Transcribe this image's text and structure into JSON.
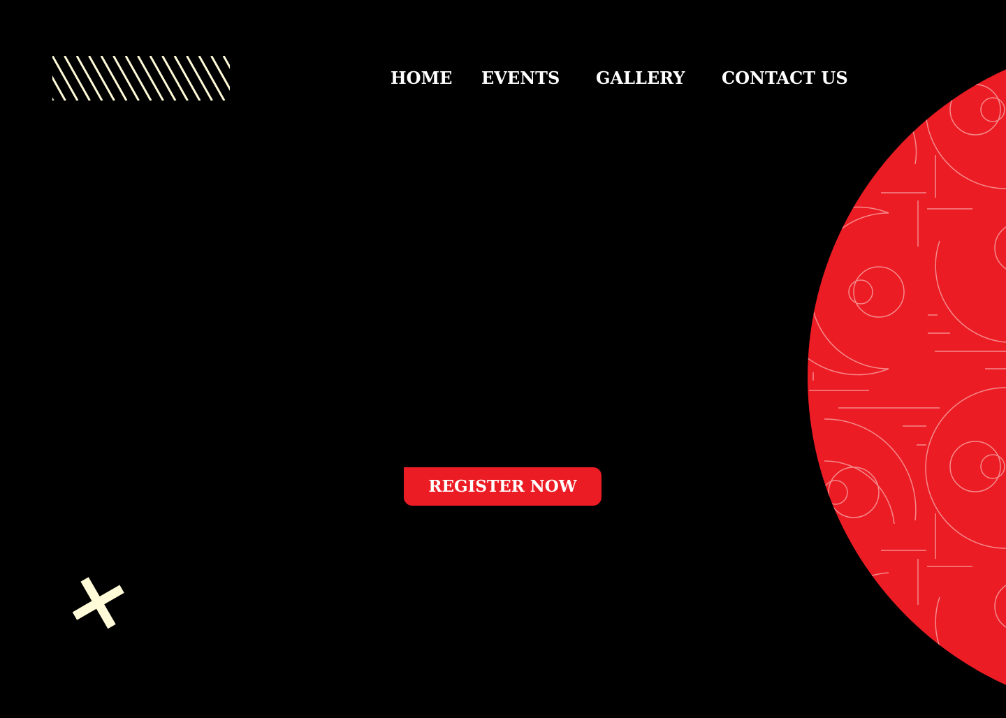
{
  "nav": {
    "items": [
      {
        "label": "HOME"
      },
      {
        "label": "EVENTS"
      },
      {
        "label": "GALLERY"
      },
      {
        "label": "CONTACT US"
      }
    ]
  },
  "hero": {
    "cta_label": "REGISTER NOW"
  },
  "colors": {
    "background": "#000000",
    "accent": "#ec1c24",
    "cream": "#fffbd8",
    "nav_text": "#ffffff",
    "pattern_line": "#f48a8c"
  },
  "icons": {
    "logo": "diagonal-stripes-logo",
    "decoration": "cross-icon"
  }
}
